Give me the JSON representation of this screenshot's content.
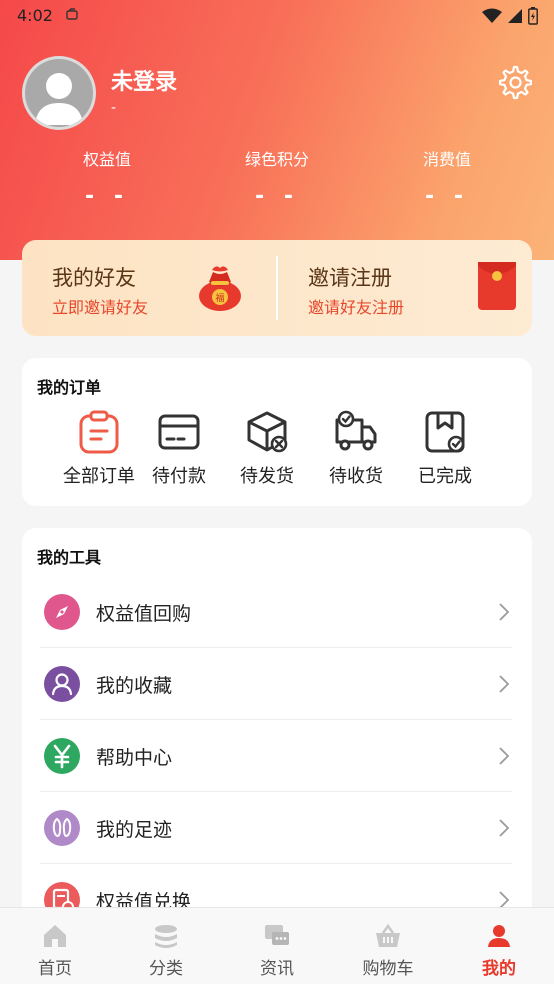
{
  "status_bar": {
    "time": "4:02"
  },
  "profile": {
    "username": "未登录",
    "subtitle": "-"
  },
  "stats": [
    {
      "label": "权益值",
      "value": "- -"
    },
    {
      "label": "绿色积分",
      "value": "- -"
    },
    {
      "label": "消费值",
      "value": "- -"
    }
  ],
  "invite": {
    "friends_title": "我的好友",
    "friends_sub": "立即邀请好友",
    "register_title": "邀请注册",
    "register_sub": "邀请好友注册"
  },
  "orders": {
    "title": "我的订单",
    "items": [
      {
        "label": "全部订单",
        "icon": "clipboard-icon"
      },
      {
        "label": "待付款",
        "icon": "card-icon"
      },
      {
        "label": "待发货",
        "icon": "box-icon"
      },
      {
        "label": "待收货",
        "icon": "truck-icon"
      },
      {
        "label": "已完成",
        "icon": "completed-icon"
      }
    ]
  },
  "tools": {
    "title": "我的工具",
    "items": [
      {
        "label": "权益值回购",
        "icon": "compass-icon",
        "color": "#e0578e"
      },
      {
        "label": "我的收藏",
        "icon": "user-icon",
        "color": "#7b4fa0"
      },
      {
        "label": "帮助中心",
        "icon": "yen-icon",
        "color": "#2ea860"
      },
      {
        "label": "我的足迹",
        "icon": "footprint-icon",
        "color": "#b08ac8"
      },
      {
        "label": "权益值兑换",
        "icon": "exchange-icon",
        "color": "#ec5b5b"
      }
    ]
  },
  "tabbar": {
    "items": [
      {
        "label": "首页",
        "icon": "home-icon"
      },
      {
        "label": "分类",
        "icon": "category-icon"
      },
      {
        "label": "资讯",
        "icon": "news-icon"
      },
      {
        "label": "购物车",
        "icon": "cart-icon"
      },
      {
        "label": "我的",
        "icon": "profile-icon",
        "active": true
      }
    ]
  },
  "colors": {
    "accent": "#e8392d",
    "hero_start": "#f5484a",
    "hero_end": "#fbb377"
  }
}
